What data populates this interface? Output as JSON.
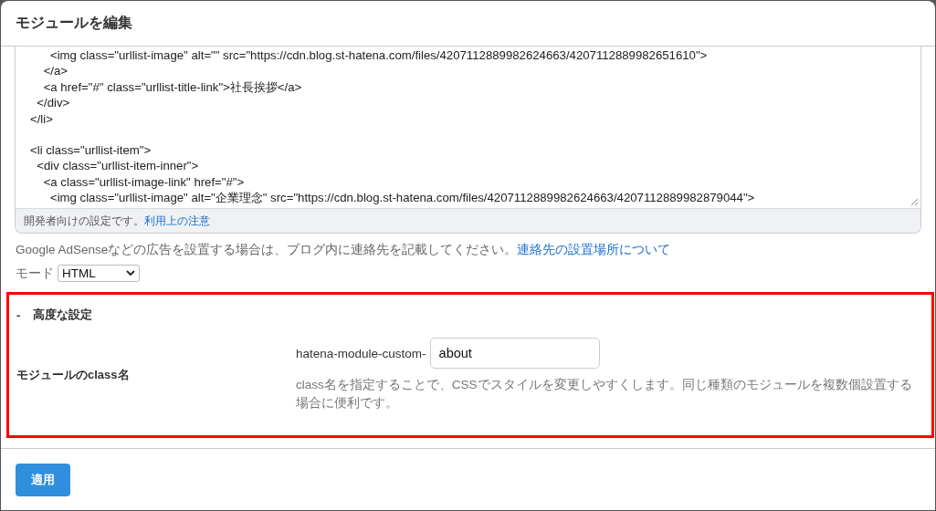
{
  "dialog": {
    "title": "モジュールを編集"
  },
  "editor": {
    "code_blocks": [
      [
        "      <img class=\"urllist-image\" alt=\"\" src=\"https://cdn.blog.st-hatena.com/files/4207112889982624663/4207112889982651610\">",
        "    </a>",
        "    <a href=\"#\" class=\"urllist-title-link\">社長挨拶</a>",
        "  </div>",
        "</li>"
      ],
      [
        "<li class=\"urllist-item\">",
        "  <div class=\"urllist-item-inner\">",
        "    <a class=\"urllist-image-link\" href=\"#\">",
        "      <img class=\"urllist-image\" alt=\"企業理念\" src=\"https://cdn.blog.st-hatena.com/files/4207112889982624663/4207112889982879044\">"
      ]
    ],
    "note": "開発者向けの設定です。",
    "note_link": "利用上の注意"
  },
  "adsense_notice": {
    "text": "Google AdSenseなどの広告を設置する場合は、ブログ内に連絡先を記載してください。",
    "link": "連絡先の設置場所について"
  },
  "mode": {
    "label": "モード",
    "value": "HTML"
  },
  "advanced": {
    "toggle": "-",
    "title": "高度な設定",
    "expanded": true,
    "field_label": "モジュールのclass名",
    "prefix": "hatena-module-custom-",
    "value": "about",
    "help": "class名を指定することで、CSSでスタイルを変更しやすくします。同じ種類のモジュールを複数個設置する場合に便利です。"
  },
  "buttons": [
    {
      "label": "適用"
    }
  ]
}
